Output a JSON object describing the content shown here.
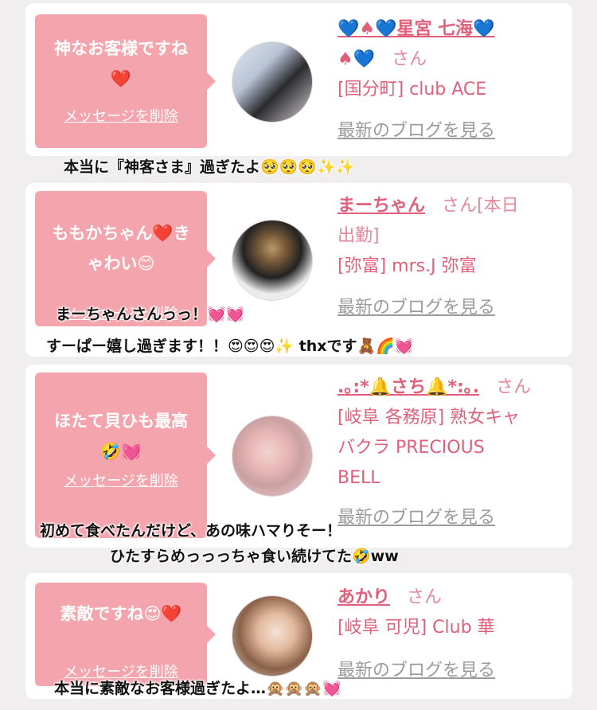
{
  "cards": [
    {
      "bubble_text_1": "神なお客様ですね",
      "bubble_text_2": "❤️",
      "delete_label": "メッセージを削除",
      "name": "💙♠💙星宮 七海💙",
      "name_line2": "♠💙",
      "san": "さん",
      "shop": "[国分町] club ACE",
      "blog": "最新のブログを見る",
      "caption": "本当に『神客さま』過ぎたよ🥺🥺🥺✨✨"
    },
    {
      "bubble_text_1": "ももかちゃん❤️き",
      "bubble_text_2": "ゃわい😊",
      "delete_label": "メッセージを削除",
      "name": "まーちゃん",
      "san": "さん[本日",
      "san_line2": "出勤]",
      "shop": "[弥富] mrs.J 弥富",
      "blog": "最新のブログを見る",
      "caption_1": "まーちゃんさんっっ！💓💓",
      "caption_2": "すーぱー嬉し過ぎます！！😍😍😍✨ thxです🧸🌈💓"
    },
    {
      "bubble_text_1": "ほたて貝ひも最高",
      "bubble_text_2": "🤣💓",
      "delete_label": "メッセージを削除",
      "name": ".｡:*🔔さち🔔*:｡.",
      "san": "さん",
      "shop_1": "[岐阜 各務原]  熟女キャ",
      "shop_2": "バクラ PRECIOUS",
      "shop_3": "BELL",
      "blog": "最新のブログを見る",
      "caption_1": "初めて食べたんだけど、あの味ハマりそー！",
      "caption_2": "ひたすらめっっっちゃ食い続けてた🤣ww"
    },
    {
      "bubble_text_1": "素敵ですね😍❤️",
      "delete_label": "メッセージを削除",
      "name": "あかり",
      "san": "さん",
      "shop": "[岐阜 可児] Club 華",
      "blog": "最新のブログを見る",
      "caption": "本当に素敵なお客様過ぎたよ…🙊🙊🙊💓"
    }
  ],
  "colors": {
    "bubble": "#f4a4ac",
    "name": "#e0607a",
    "blog_link": "#9b9b9b",
    "background": "#f0eeee"
  }
}
